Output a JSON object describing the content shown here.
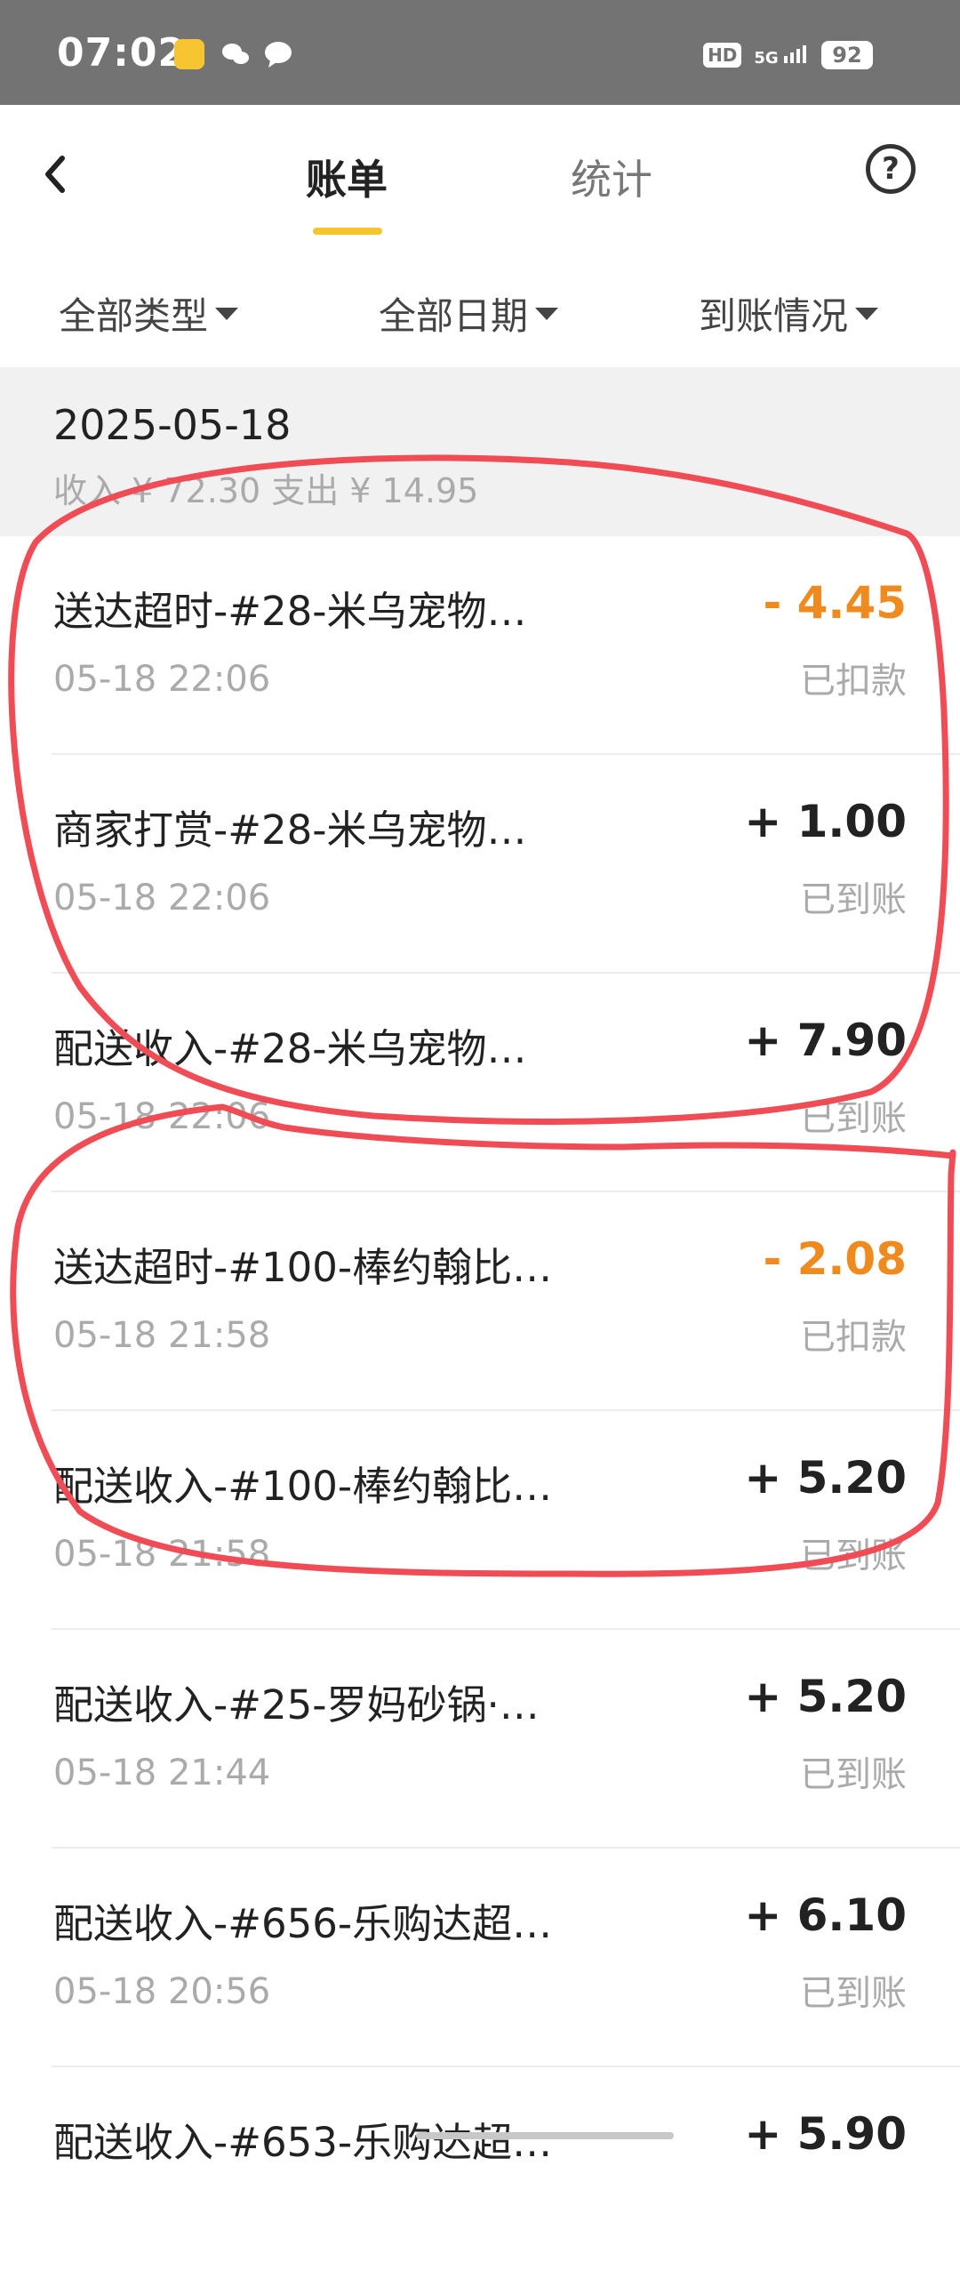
{
  "status_bar": {
    "time": "07:02",
    "network": "5G",
    "hd": "HD",
    "battery": "92",
    "icons": [
      "weibo-app-icon",
      "wechat-icon",
      "message-icon"
    ]
  },
  "nav": {
    "back_icon": "chevron-left-icon",
    "tabs": [
      {
        "label": "账单",
        "active": true
      },
      {
        "label": "统计",
        "active": false
      }
    ],
    "help_icon": "question-circle-icon",
    "help_glyph": "?"
  },
  "filters": [
    {
      "label": "全部类型"
    },
    {
      "label": "全部日期"
    },
    {
      "label": "到账情况"
    }
  ],
  "section": {
    "date": "2025-05-18",
    "summary": "收入 ¥ 72.30 支出 ¥ 14.95"
  },
  "transactions": [
    {
      "title": "送达超时-#28-米乌宠物…",
      "time": "05-18 22:06",
      "amount": "- 4.45",
      "status": "已扣款",
      "type": "negative"
    },
    {
      "title": "商家打赏-#28-米乌宠物…",
      "time": "05-18 22:06",
      "amount": "+ 1.00",
      "status": "已到账",
      "type": "positive"
    },
    {
      "title": "配送收入-#28-米乌宠物…",
      "time": "05-18 22:06",
      "amount": "+ 7.90",
      "status": "已到账",
      "type": "positive"
    },
    {
      "title": "送达超时-#100-棒约翰比…",
      "time": "05-18 21:58",
      "amount": "- 2.08",
      "status": "已扣款",
      "type": "negative"
    },
    {
      "title": "配送收入-#100-棒约翰比…",
      "time": "05-18 21:58",
      "amount": "+ 5.20",
      "status": "已到账",
      "type": "positive"
    },
    {
      "title": "配送收入-#25-罗妈砂锅·…",
      "time": "05-18 21:44",
      "amount": "+ 5.20",
      "status": "已到账",
      "type": "positive"
    },
    {
      "title": "配送收入-#656-乐购达超…",
      "time": "05-18 20:56",
      "amount": "+ 6.10",
      "status": "已到账",
      "type": "positive"
    },
    {
      "title": "配送收入-#653-乐购达超…",
      "time": "",
      "amount": "+ 5.90",
      "status": "",
      "type": "positive"
    }
  ],
  "colors": {
    "accent": "#f6c42b",
    "negative_amount": "#ef8a1e",
    "annotation": "#f04c55",
    "status_bar": "#737373"
  }
}
